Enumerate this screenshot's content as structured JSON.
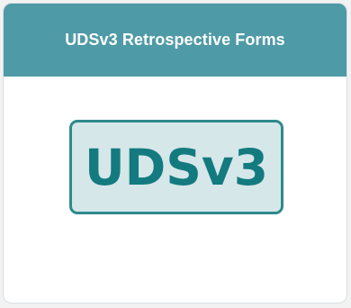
{
  "card": {
    "title": "UDSv3 Retrospective Forms",
    "logo_text": "UDSv3",
    "colors": {
      "header": "#4e9aa6",
      "logo_fill": "#d6e7e9",
      "logo_border": "#2e8a8e",
      "logo_text": "#137b80"
    }
  }
}
